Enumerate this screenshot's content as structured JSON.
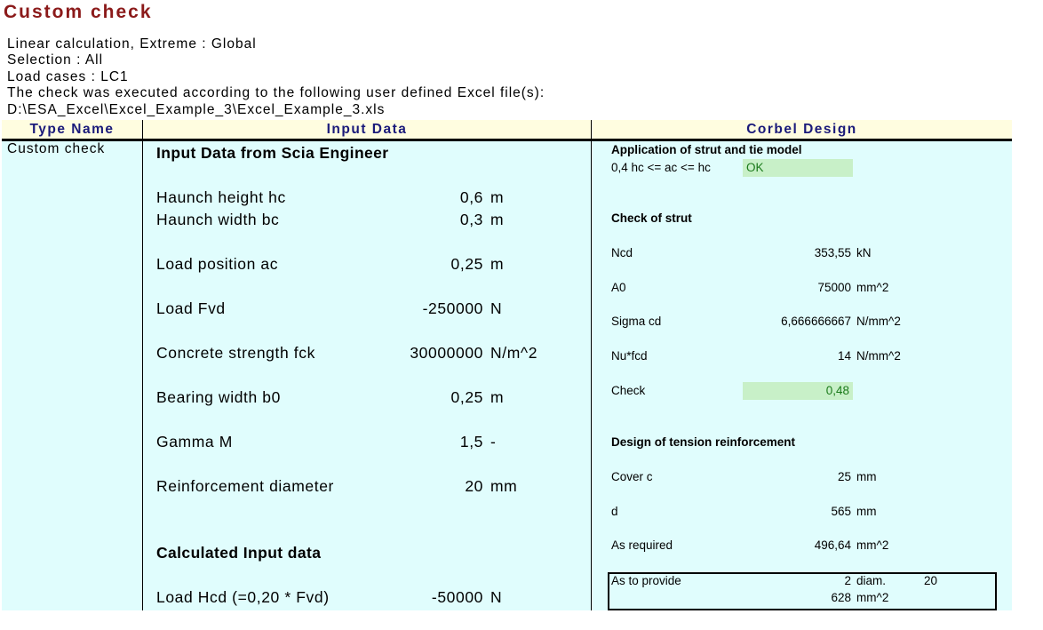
{
  "title": "Custom check",
  "meta": {
    "line1": "Linear calculation, Extreme : Global",
    "line2": "Selection : All",
    "line3": "Load cases : LC1",
    "line4": "The  check was  executed according to the  following user defined Excel file(s):",
    "line5": "D:\\ESA_Excel\\Excel_Example_3\\Excel_Example_3.xls"
  },
  "table": {
    "col_type": "Type Name",
    "col_input": "Input Data",
    "col_design": "Corbel Design",
    "row_type": "Custom check"
  },
  "input": {
    "section1": "Input Data from Scia Engineer",
    "rows": [
      {
        "label": "Haunch height hc",
        "value": "0,6",
        "unit": "m"
      },
      {
        "label": "Haunch width bc",
        "value": "0,3",
        "unit": "m"
      },
      {
        "label": "Load position ac",
        "value": "0,25",
        "unit": "m"
      },
      {
        "label": "Load Fvd",
        "value": "-250000",
        "unit": "N"
      },
      {
        "label": "Concrete strength fck",
        "value": "30000000",
        "unit": "N/m^2"
      },
      {
        "label": "Bearing width b0",
        "value": "0,25",
        "unit": "m"
      },
      {
        "label": "Gamma M",
        "value": "1,5",
        "unit": "-"
      },
      {
        "label": "Reinforcement diameter",
        "value": "20",
        "unit": "mm"
      }
    ],
    "section2": "Calculated Input data",
    "calc": {
      "label": "Load Hcd (=0,20 * Fvd)",
      "value": "-50000",
      "unit": "N"
    }
  },
  "design": {
    "strut_tie_title": "Application of strut and tie model",
    "strut_tie_cond": "0,4 hc <= ac <= hc",
    "strut_tie_result": "OK",
    "strut_title": "Check of strut",
    "strut_rows": [
      {
        "label": "Ncd",
        "value": "353,55",
        "unit": "kN"
      },
      {
        "label": "A0",
        "value": "75000",
        "unit": "mm^2"
      },
      {
        "label": "Sigma cd",
        "value": "6,666666667",
        "unit": "N/mm^2"
      },
      {
        "label": "Nu*fcd",
        "value": "14",
        "unit": "N/mm^2"
      }
    ],
    "check_label": "Check",
    "check_value": "0,48",
    "tension_title": "Design of tension reinforcement",
    "tension_rows": [
      {
        "label": "Cover c",
        "value": "25",
        "unit": "mm"
      },
      {
        "label": "d",
        "value": "565",
        "unit": "mm"
      },
      {
        "label": "As required",
        "value": "496,64",
        "unit": "mm^2"
      }
    ],
    "provide": {
      "label": "As to provide",
      "count": "2",
      "diam_label": "diam.",
      "diam_value": "20",
      "area_value": "628",
      "area_unit": "mm^2"
    }
  }
}
